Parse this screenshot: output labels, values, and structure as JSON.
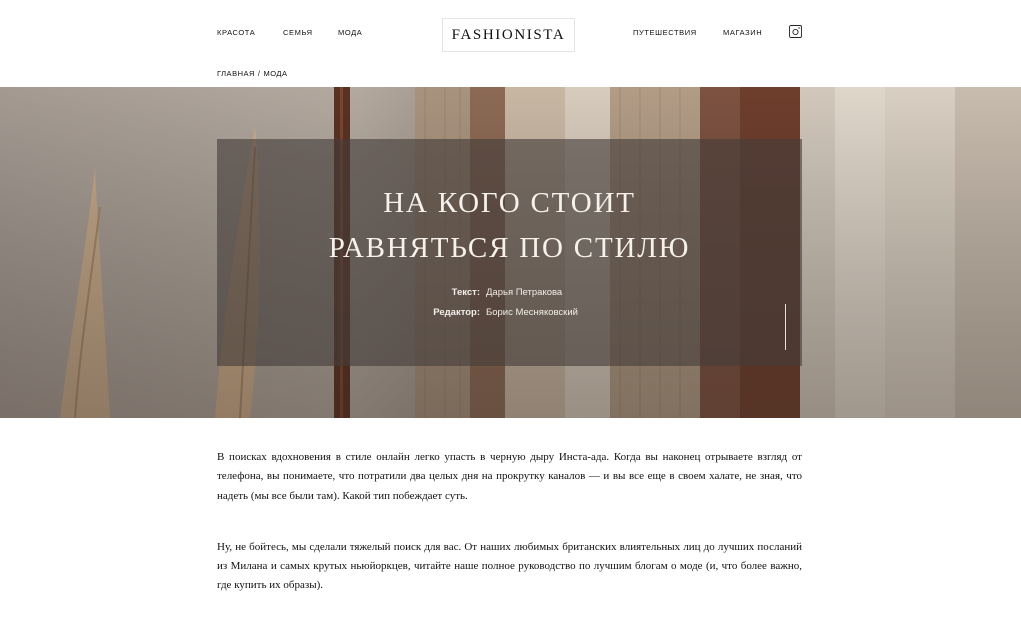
{
  "header": {
    "nav_left": [
      "КРАСОТА",
      "СЕМЬЯ",
      "МОДА"
    ],
    "logo": "FASHIONISTA",
    "nav_right": [
      "ПУТЕШЕСТВИЯ",
      "МАГАЗИН"
    ],
    "social_icon": "instagram-icon"
  },
  "breadcrumb": {
    "home": "ГЛАВНАЯ",
    "separator": "/",
    "current": "МОДА"
  },
  "hero": {
    "title_line1": "НА КОГО СТОИТ",
    "title_line2": "РАВНЯТЬСЯ ПО СТИЛЮ",
    "text_label": "Текст:",
    "text_author": "Дарья Петракова",
    "editor_label": "Редактор:",
    "editor_name": "Борис Месняковский",
    "image_subject": "pampas-grass-and-knit-sweaters-on-rack"
  },
  "article": {
    "paragraphs": [
      "В поисках вдохновения в стиле онлайн легко упасть в черную дыру Инста-ада. Когда вы наконец отрываете взгляд от телефона, вы понимаете, что потратили два целых дня на прокрутку каналов — и вы все еще в своем халате, не зная, что надеть (мы все были там). Какой тип побеждает суть.",
      "Ну, не бойтесь, мы сделали тяжелый поиск для вас. От наших любимых британских влиятельных лиц до лучших посланий из Милана и самых крутых ньюйоркцев, читайте наше полное руководство по лучшим блогам о моде (и, что более важно, где купить их образы)."
    ]
  },
  "colors": {
    "panel_overlay": "#463e3a",
    "hero_text": "#f6f1ea"
  }
}
